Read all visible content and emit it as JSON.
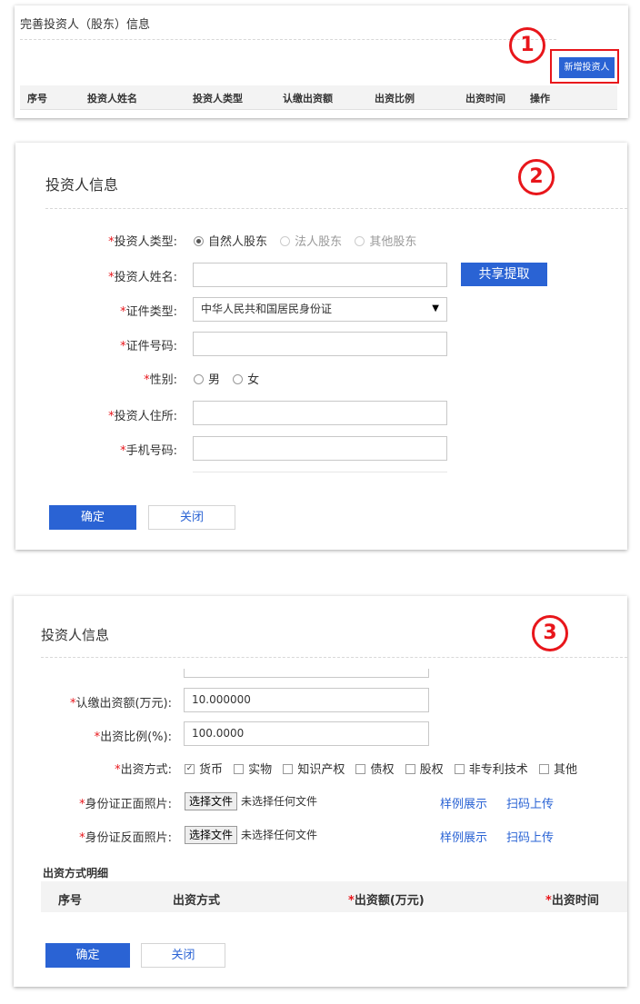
{
  "panel1": {
    "title": "完善投资人（股东）信息",
    "step": "1",
    "add_button": "新增投资人",
    "columns": [
      "序号",
      "投资人姓名",
      "投资人类型",
      "认缴出资额",
      "出资比例",
      "出资时间",
      "操作"
    ]
  },
  "panel2": {
    "title": "投资人信息",
    "step": "2",
    "investor_type": {
      "label": "投资人类型:",
      "options": [
        "自然人股东",
        "法人股东",
        "其他股东"
      ],
      "selected": "自然人股东"
    },
    "name": {
      "label": "投资人姓名:",
      "value": ""
    },
    "share_button": "共享提取",
    "id_type": {
      "label": "证件类型:",
      "value": "中华人民共和国居民身份证"
    },
    "id_number": {
      "label": "证件号码:",
      "value": ""
    },
    "gender": {
      "label": "性别:",
      "options": [
        "男",
        "女"
      ]
    },
    "address": {
      "label": "投资人住所:",
      "value": ""
    },
    "phone": {
      "label": "手机号码:",
      "value": ""
    },
    "confirm": "确定",
    "close": "关闭"
  },
  "panel3": {
    "title": "投资人信息",
    "step": "3",
    "amount": {
      "label": "认缴出资额(万元):",
      "value": "10.000000"
    },
    "ratio": {
      "label": "出资比例(%):",
      "value": "100.0000"
    },
    "method": {
      "label": "出资方式:",
      "options": [
        "货币",
        "实物",
        "知识产权",
        "债权",
        "股权",
        "非专利技术",
        "其他"
      ],
      "checked": "货币"
    },
    "id_front": {
      "label": "身份证正面照片:",
      "choose": "选择文件",
      "status": "未选择任何文件",
      "sample": "样例展示",
      "scan": "扫码上传"
    },
    "id_back": {
      "label": "身份证反面照片:",
      "choose": "选择文件",
      "status": "未选择任何文件",
      "sample": "样例展示",
      "scan": "扫码上传"
    },
    "detail_title": "出资方式明细",
    "detail_columns": [
      "序号",
      "出资方式",
      "出资额(万元)",
      "出资时间"
    ],
    "confirm": "确定",
    "close": "关闭"
  },
  "colors": {
    "accent_blue": "#2a63d4",
    "required_red": "#e8161b"
  }
}
